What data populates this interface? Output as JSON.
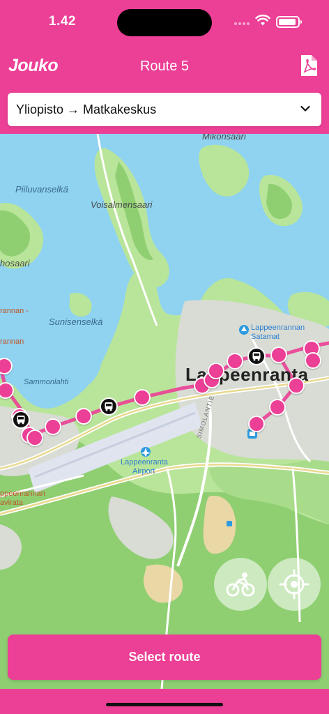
{
  "status_bar": {
    "time": "1.42"
  },
  "header": {
    "logo": "Jouko",
    "title": "Route 5"
  },
  "route_selector": {
    "value": "Yliopisto → Matkakeskus"
  },
  "map": {
    "labels": {
      "mikonsaari": "Mikonsaari",
      "piiluvanselka": "Piiluvanselkä",
      "voisalmensaari": "Voisalmensaari",
      "hosaari": "hosaari",
      "sunisenselka": "Sunisenselkä",
      "rannan1": "rannan -",
      "rannan2": "rannan",
      "sammonlahti": "Sammonlahti",
      "city": "Lappeenranta",
      "satamat_1": "Lappeenrannan",
      "satamat_2": "Satamat",
      "simolantie": "SIMOLANTIE",
      "airport_1": "Lappeenranta",
      "airport_2": "Airport",
      "bottom_1": "ppeenrannan",
      "bottom_2": "avirata"
    }
  },
  "cta": {
    "label": "Select route"
  },
  "colors": {
    "brand": "#ec3f96",
    "water": "#8fd3f0",
    "land": "#b9e59a",
    "forest": "#8fcf72"
  },
  "icons": [
    "wifi-icon",
    "battery-icon",
    "pdf-icon",
    "chevron-down-icon",
    "bus-icon",
    "cycling-icon",
    "locate-icon",
    "airport-icon",
    "harbor-icon"
  ]
}
